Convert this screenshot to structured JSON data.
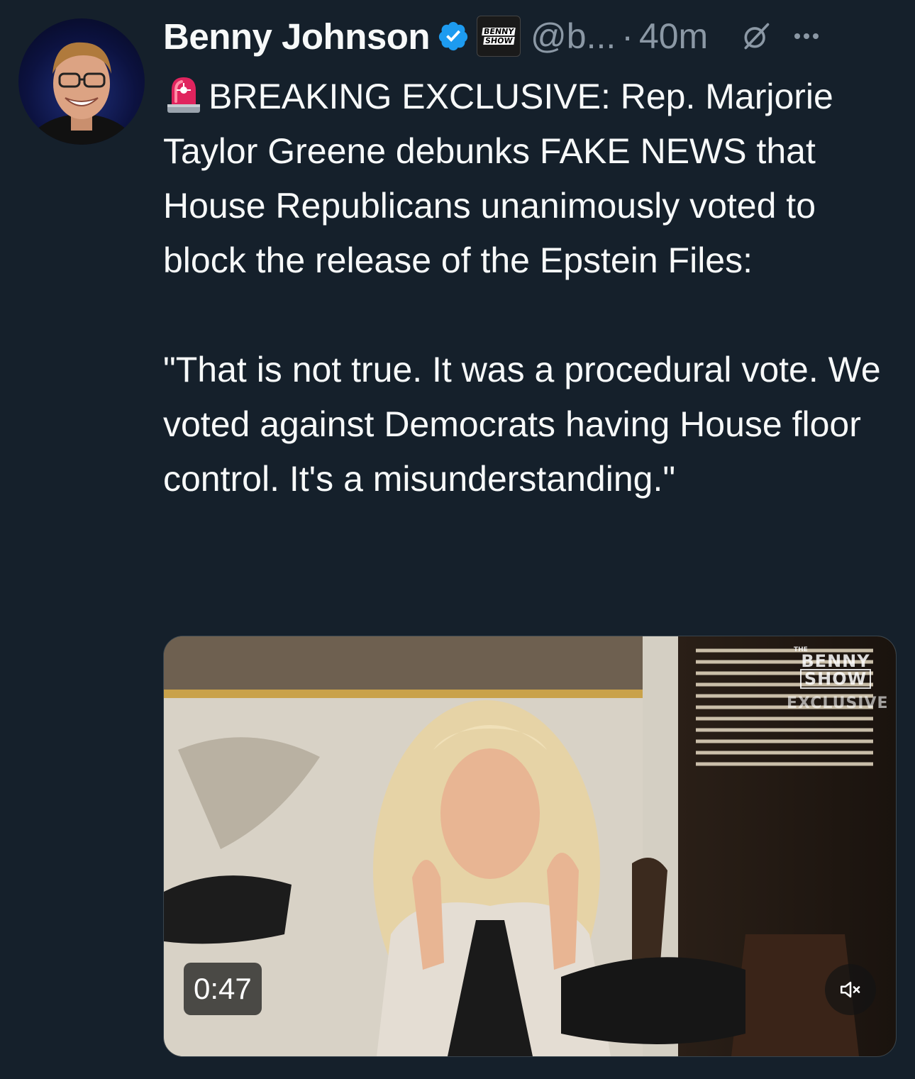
{
  "author": {
    "name": "Benny Johnson",
    "handle": "@b...",
    "separator": "·",
    "time": "40m",
    "affiliate_badge": [
      "BENNY",
      "SHOW"
    ]
  },
  "tweet": {
    "paragraph1": "BREAKING EXCLUSIVE: Rep. Marjorie Taylor Greene debunks FAKE NEWS that House Republicans unanimously voted to block the release of the Epstein Files:",
    "paragraph2": "\"That is not true. It was a procedural vote. We voted against Democrats having House floor control. It's a misunderstanding.\""
  },
  "video": {
    "duration": "0:47",
    "watermark": {
      "the": "THE",
      "benny": "BENNY",
      "show": "SHOW",
      "exclusive": "EXCLUSIVE"
    }
  },
  "icons": {
    "verified": "verified-badge-icon",
    "siren": "police-light-emoji",
    "grok": "grok-icon",
    "more": "more-icon",
    "mute": "speaker-muted-icon"
  },
  "colors": {
    "background": "#15202b",
    "text": "#f7f9f9",
    "secondary": "#8b98a5",
    "verified_blue": "#1d9bf0",
    "siren_red": "#e0245e"
  }
}
